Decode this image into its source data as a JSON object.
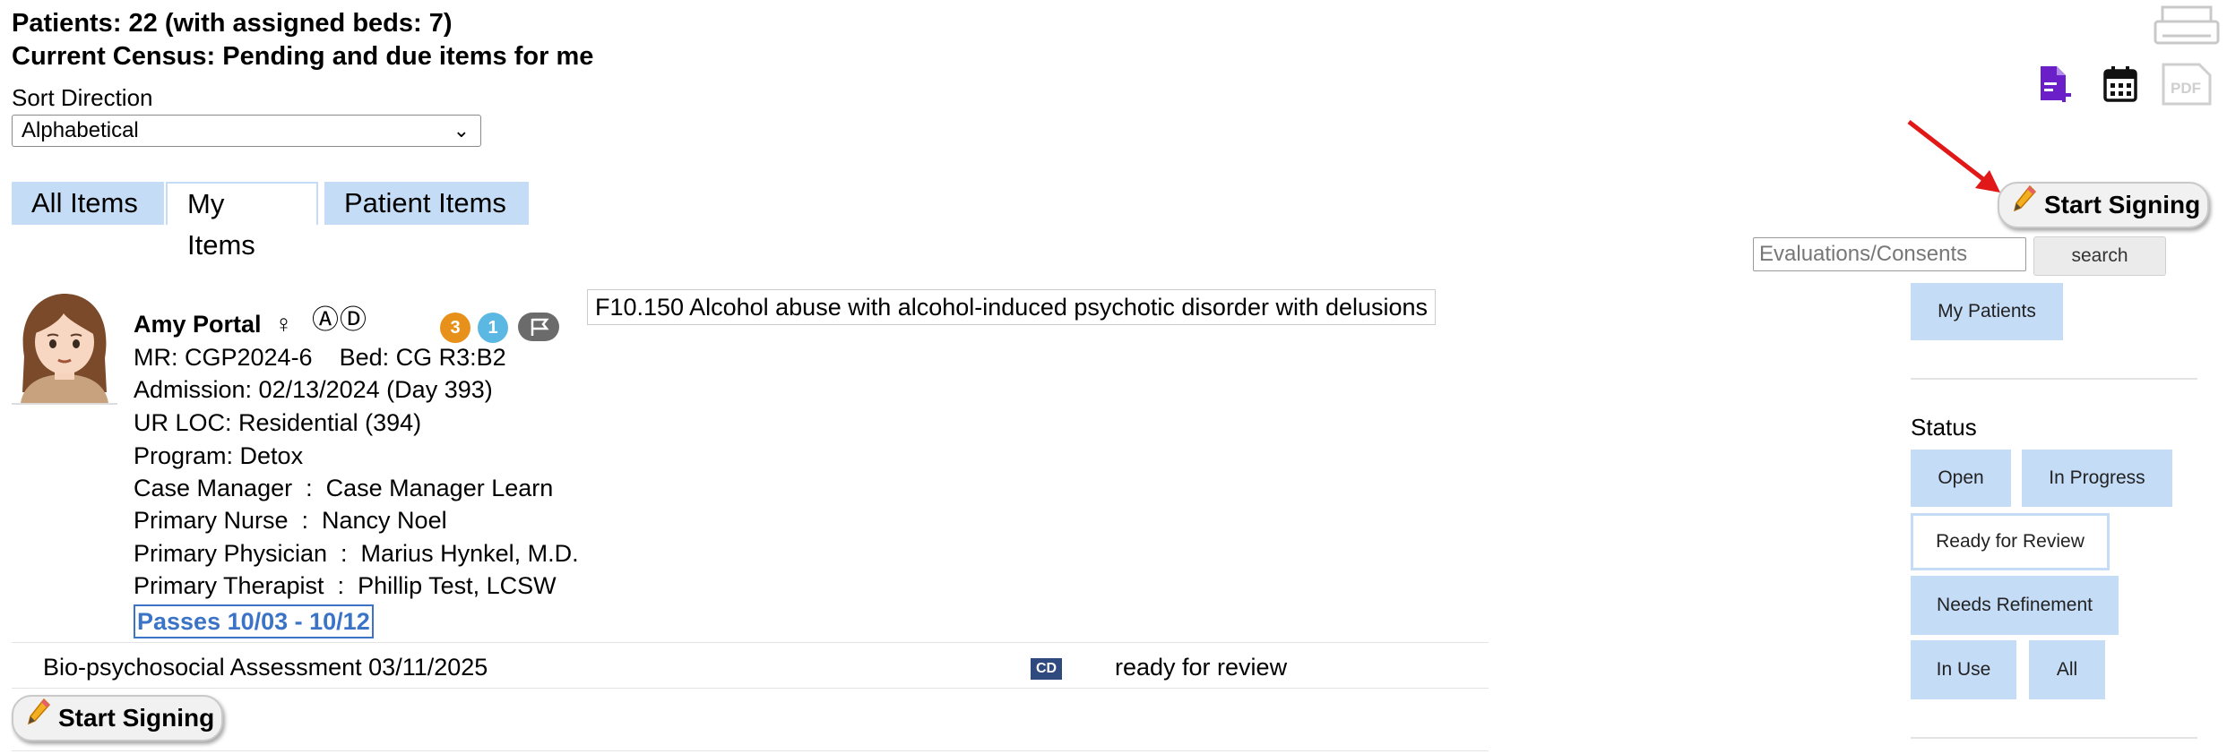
{
  "header": {
    "patients_line": "Patients: 22 (with assigned beds: 7)",
    "census_line": "Current Census: Pending and due items for me"
  },
  "sort": {
    "label": "Sort Direction",
    "selected": "Alphabetical"
  },
  "tabs": [
    {
      "label": "All Items",
      "active": false
    },
    {
      "label": "My Items",
      "active": true
    },
    {
      "label": "Patient Items",
      "active": false
    }
  ],
  "toolbar": {
    "icons": [
      "printer-icon",
      "add-document-icon",
      "calendar-icon",
      "pdf-icon"
    ],
    "start_signing_label": "Start Signing"
  },
  "search": {
    "placeholder": "Evaluations/Consents",
    "button_label": "search"
  },
  "filters": {
    "my_patients_label": "My Patients",
    "status_heading": "Status",
    "status_buttons": [
      {
        "label": "Open",
        "selected": false
      },
      {
        "label": "In Progress",
        "selected": false
      },
      {
        "label": "Ready for Review",
        "selected": true
      },
      {
        "label": "Needs Refinement",
        "selected": false
      },
      {
        "label": "In Use",
        "selected": false
      },
      {
        "label": "All",
        "selected": false
      }
    ]
  },
  "patient": {
    "name": "Amy Portal",
    "gender_symbol": "♀",
    "status_icons": "ⒶⒹ",
    "badges": [
      {
        "value": "3",
        "color": "#e8911a"
      },
      {
        "value": "1",
        "color": "#5bb8e3"
      }
    ],
    "mr_line": "MR: CGP2024-6    Bed: CG R3:B2",
    "admission_line": "Admission: 02/13/2024 (Day 393)",
    "ur_loc_line": "UR LOC: Residential (394)",
    "program_line": "Program: Detox",
    "case_manager_line": "Case Manager  :  Case Manager Learn",
    "primary_nurse_line": "Primary Nurse  :  Nancy Noel",
    "primary_physician_line": "Primary Physician  :  Marius Hynkel, M.D.",
    "primary_therapist_line": "Primary Therapist  :  Phillip Test, LCSW",
    "passes_link": "Passes 10/03 - 10/12",
    "diagnosis": "F10.150 Alcohol abuse with alcohol-induced psychotic disorder with delusions"
  },
  "items": [
    {
      "title": "Bio-psychosocial Assessment 03/11/2025",
      "badge": "CD",
      "status": "ready for review"
    }
  ],
  "row_action": {
    "start_signing_label": "Start Signing"
  },
  "colors": {
    "tab_bg": "#c5dcf7",
    "link": "#3b73c7",
    "arrow": "#e01818",
    "add_doc_icon": "#6a1fc9"
  }
}
